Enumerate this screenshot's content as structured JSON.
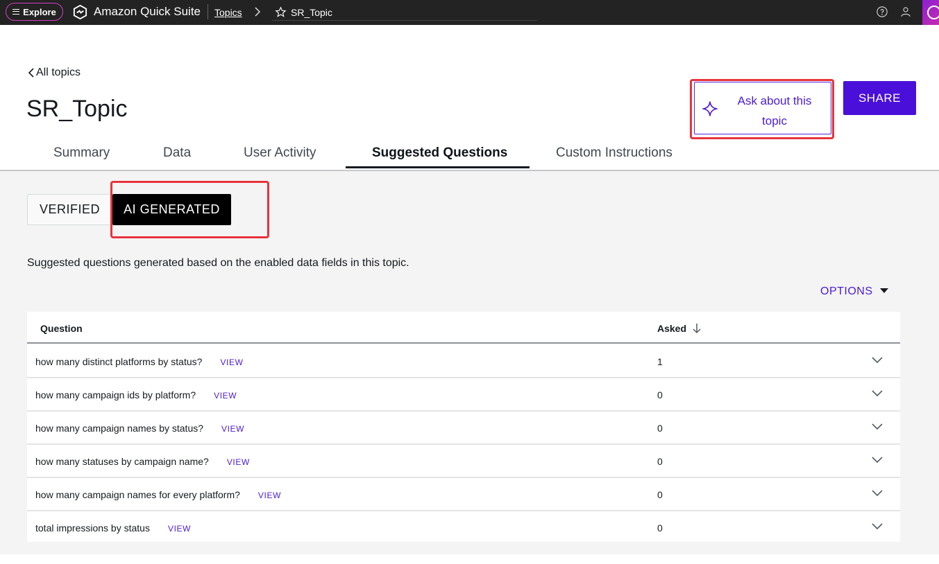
{
  "topbar": {
    "explore_label": "Explore",
    "app_name": "Amazon Quick Suite",
    "breadcrumb_topics": "Topics",
    "breadcrumb_current": "SR_Topic"
  },
  "header": {
    "back_label": "All topics",
    "title": "SR_Topic",
    "ask_label_line1": "Ask about this",
    "ask_label_line2": "topic",
    "share_label": "SHARE"
  },
  "tabs": [
    {
      "label": "Summary"
    },
    {
      "label": "Data"
    },
    {
      "label": "User Activity"
    },
    {
      "label": "Suggested Questions"
    },
    {
      "label": "Custom Instructions"
    }
  ],
  "segmented": {
    "verified_label": "VERIFIED",
    "ai_label": "AI GENERATED",
    "selected": "AI GENERATED"
  },
  "description": "Suggested questions generated based on the enabled data fields in this topic.",
  "options_label": "OPTIONS",
  "table": {
    "col_question": "Question",
    "col_asked": "Asked",
    "view_label": "VIEW",
    "rows": [
      {
        "question": "how many distinct platforms by status?",
        "asked": "1"
      },
      {
        "question": "how many campaign ids by platform?",
        "asked": "0"
      },
      {
        "question": "how many campaign names by status?",
        "asked": "0"
      },
      {
        "question": "how many statuses by campaign name?",
        "asked": "0"
      },
      {
        "question": "how many campaign names for every platform?",
        "asked": "0"
      },
      {
        "question": "total impressions by status",
        "asked": "0"
      }
    ]
  },
  "colors": {
    "accent": "#4a1ad6",
    "highlight": "#e8333c",
    "topbar": "#232323"
  }
}
